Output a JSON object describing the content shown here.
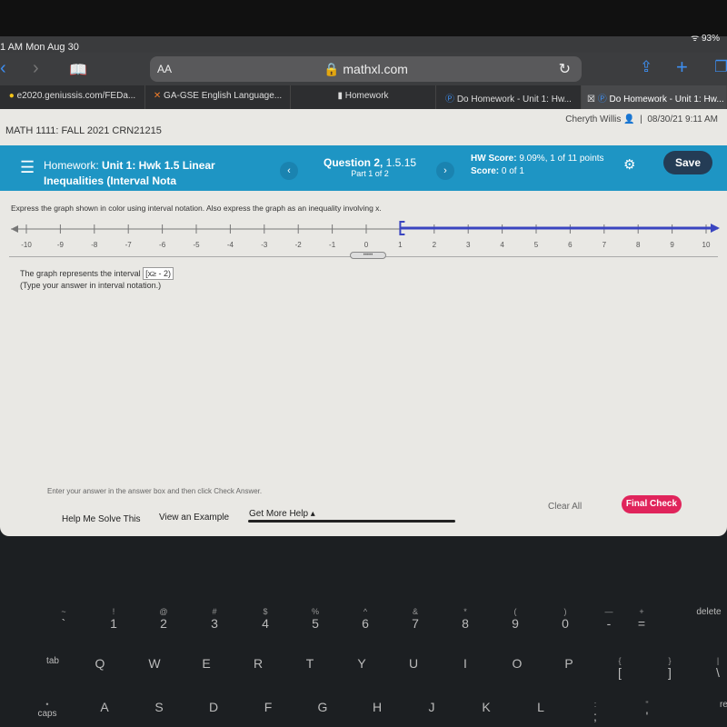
{
  "status": {
    "time": "1 AM  Mon Aug 30",
    "battery": "93%"
  },
  "browser": {
    "text_size": "AA",
    "url": "mathxl.com",
    "tabs": [
      {
        "label": "e2020.geniussis.com/FEDa...",
        "icon": "lightbulb-icon"
      },
      {
        "label": "GA-GSE English Language...",
        "icon": "x-logo-icon"
      },
      {
        "label": "Homework",
        "icon": "document-icon"
      },
      {
        "label": "Do Homework - Unit 1: Hw...",
        "icon": "pearson-p-icon"
      },
      {
        "label": "Do Homework - Unit 1: Hw...",
        "icon": "pearson-p-icon",
        "active": true
      }
    ]
  },
  "header": {
    "course": "MATH 1111: FALL 2021 CRN21215",
    "user": "Cheryth Willis",
    "datetime": "08/30/21 9:11 AM"
  },
  "hwbar": {
    "prefix": "Homework: ",
    "title1": "Unit 1: Hwk 1.5 Linear",
    "title2": "Inequalities (Interval Nota",
    "question": "Question 2,",
    "question_num": " 1.5.15",
    "part": "Part 1 of 2",
    "hw_score_label": "HW Score:",
    "hw_score": " 9.09%, 1 of 11 points",
    "score_label": "Score:",
    "score": " 0 of 1",
    "save": "Save",
    "color": "#1e95c4"
  },
  "question": {
    "prompt": "Express the graph shown in color using interval notation. Also express the graph as an inequality involving x.",
    "number_line": {
      "min": -10,
      "max": 10,
      "ticks": [
        -10,
        -9,
        -8,
        -7,
        -6,
        -5,
        -4,
        -3,
        -2,
        -1,
        0,
        1,
        2,
        3,
        4,
        5,
        6,
        7,
        8,
        9,
        10
      ],
      "shaded_from": 1,
      "endpoint": "closed-bracket",
      "direction": "right",
      "color": "#3a45c0"
    },
    "answer_label": "The graph represents the interval",
    "answer_value": "[x≥ - 2)",
    "hint": "(Type your answer in interval notation.)"
  },
  "footer": {
    "instruction": "Enter your answer in the answer box and then click Check Answer.",
    "help_me": "Help Me Solve This",
    "example": "View an Example",
    "more_help": "Get More Help ▴",
    "clear_all": "Clear All",
    "final_check": "Final Check"
  },
  "keyboard": {
    "rows": [
      [
        [
          "~",
          "`"
        ],
        [
          "!",
          "1"
        ],
        [
          "@",
          "2"
        ],
        [
          "#",
          "3"
        ],
        [
          "$",
          "4"
        ],
        [
          "%",
          "5"
        ],
        [
          "^",
          "6"
        ],
        [
          "&",
          "7"
        ],
        [
          "*",
          "8"
        ],
        [
          "(",
          "9"
        ],
        [
          ")",
          "0"
        ],
        [
          "—",
          "-"
        ],
        [
          "+",
          "="
        ],
        [
          "",
          "delete"
        ]
      ],
      [
        [
          "",
          "tab"
        ],
        [
          "",
          "Q"
        ],
        [
          "",
          "W"
        ],
        [
          "",
          "E"
        ],
        [
          "",
          "R"
        ],
        [
          "",
          "T"
        ],
        [
          "",
          "Y"
        ],
        [
          "",
          "U"
        ],
        [
          "",
          "I"
        ],
        [
          "",
          "O"
        ],
        [
          "",
          "P"
        ],
        [
          "{",
          "["
        ],
        [
          "}",
          "]"
        ],
        [
          "|",
          "\\"
        ]
      ],
      [
        [
          "•",
          "caps"
        ],
        [
          "",
          "A"
        ],
        [
          "",
          "S"
        ],
        [
          "",
          "D"
        ],
        [
          "",
          "F"
        ],
        [
          "",
          "G"
        ],
        [
          "",
          "H"
        ],
        [
          "",
          "J"
        ],
        [
          "",
          "K"
        ],
        [
          "",
          "L"
        ],
        [
          ":",
          ";"
        ],
        [
          "\"",
          "'"
        ],
        [
          "",
          "return"
        ]
      ]
    ]
  }
}
